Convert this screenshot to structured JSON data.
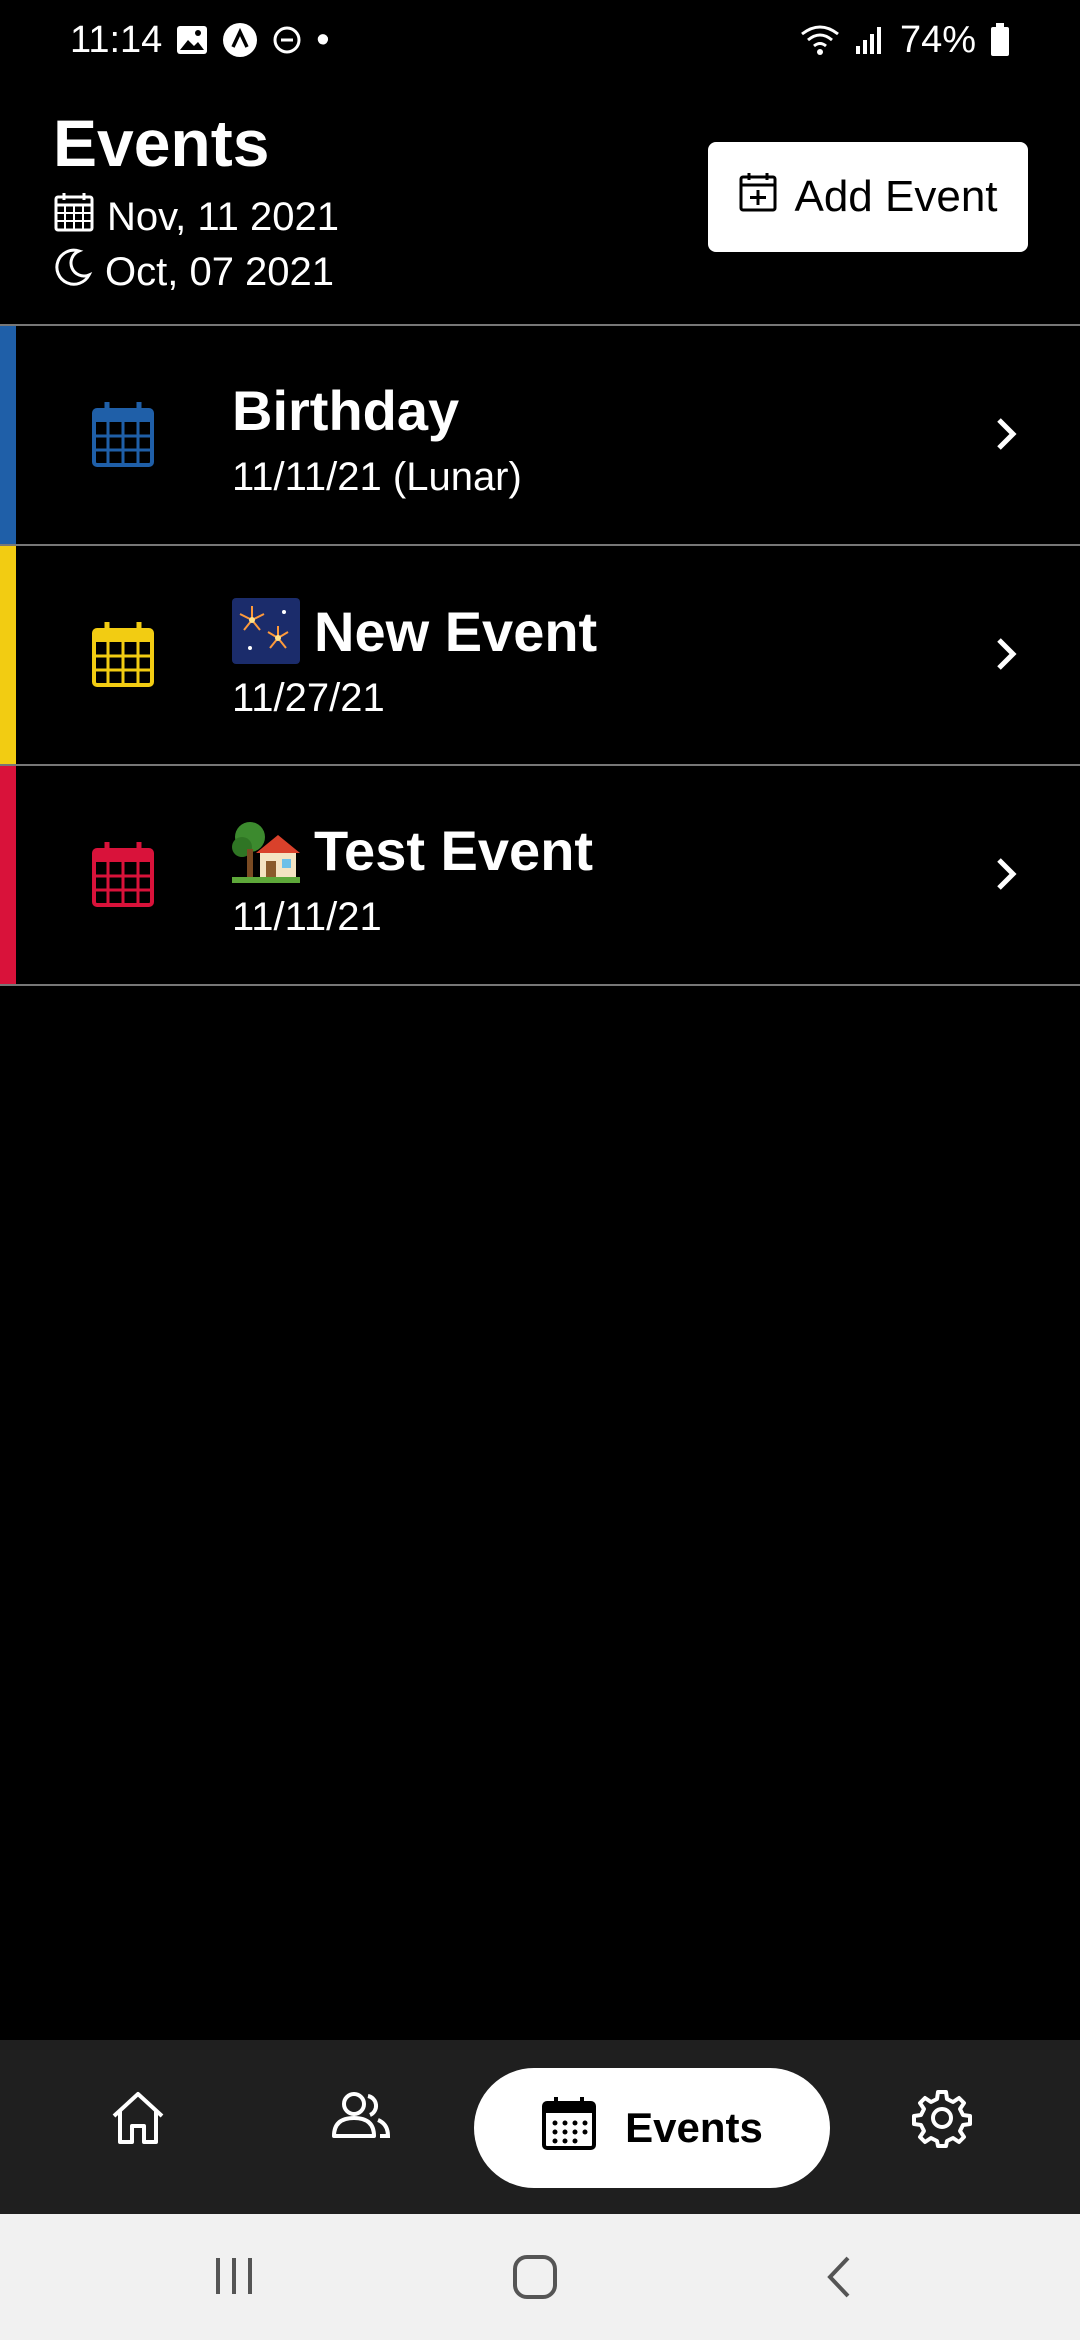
{
  "status_bar": {
    "time": "11:14",
    "battery": "74%",
    "dot": "•"
  },
  "header": {
    "title": "Events",
    "solar_date": "Nov, 11 2021",
    "lunar_date": "Oct, 07 2021",
    "add_button_label": "Add Event"
  },
  "events": [
    {
      "name": "Birthday",
      "date": "11/11/21 (Lunar)",
      "color": "#1f5fa8",
      "emoji": ""
    },
    {
      "name": "New Event",
      "date": "11/27/21",
      "color": "#f2cc12",
      "emoji": "fireworks"
    },
    {
      "name": "Test Event",
      "date": "11/11/21",
      "color": "#d9123a",
      "emoji": "house-with-garden"
    }
  ],
  "bottom_nav": {
    "items": [
      "home-icon",
      "people-icon",
      "events",
      "gear-icon"
    ],
    "active_label": "Events"
  },
  "system_nav": [
    "recents",
    "home",
    "back"
  ]
}
